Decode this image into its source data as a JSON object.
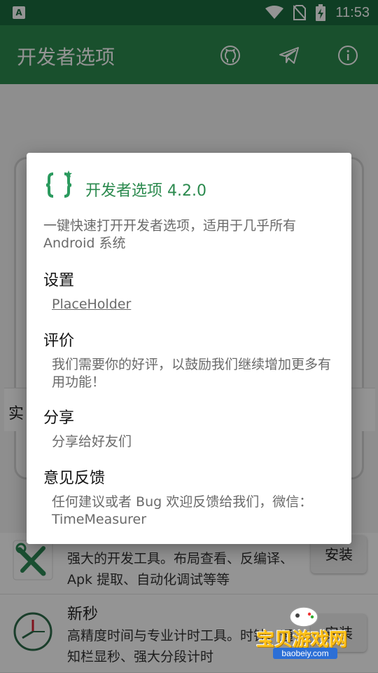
{
  "status_bar": {
    "time": "11:53",
    "left_icon": "A",
    "icons": [
      "wifi-icon",
      "no-sim-icon",
      "battery-charging-icon"
    ]
  },
  "app_bar": {
    "title": "开发者选项",
    "actions": [
      "github-icon",
      "telegram-icon",
      "info-icon"
    ],
    "color": "#2b8a4e",
    "status_color": "#1a6b3f"
  },
  "background": {
    "section_label": "实",
    "apps": [
      {
        "name": "",
        "description": "强大的开发工具。布局查看、反编译、Apk 提取、自动化调试等等",
        "button": "安装",
        "icon": "wrench-screwdriver-icon"
      },
      {
        "name": "新秒",
        "description": "高精度时间与专业计时工具。时钟、通知栏显秒、强大分段计时",
        "button": "安装",
        "icon": "clock-icon"
      }
    ]
  },
  "dialog": {
    "title": "开发者选项 4.2.0",
    "logo_icon": "curly-braces-star-icon",
    "intro": "一键快速打开开发者选项，适用于几乎所有 Android 系统",
    "sections": [
      {
        "heading": "设置",
        "text": "PlaceHolder"
      },
      {
        "heading": "评价",
        "text": "我们需要你的好评，以鼓励我们继续增加更多有用功能！"
      },
      {
        "heading": "分享",
        "text": "分享给好友们"
      },
      {
        "heading": "意见反馈",
        "text": "任何建议或者 Bug 欢迎反馈给我们，微信：TimeMeasurer"
      }
    ]
  },
  "watermark": {
    "text": "宝贝游戏网",
    "url": "baobeiy.com"
  }
}
